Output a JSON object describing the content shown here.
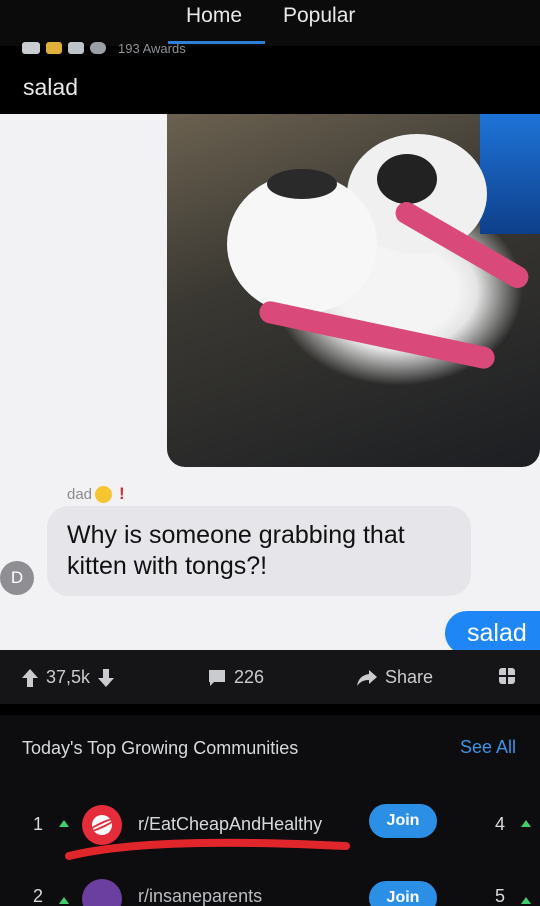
{
  "nav": {
    "tabs": [
      {
        "label": "Home"
      },
      {
        "label": "Popular"
      }
    ]
  },
  "post": {
    "awards_count": "193 Awards",
    "title": "salad",
    "image": {
      "sender_label": "dad",
      "incoming_message": "Why is someone grabbing that kitten with tongs?!",
      "avatar_letter": "D",
      "outgoing_message": "salad"
    },
    "actions": {
      "votes": "37,5k",
      "comments": "226",
      "share": "Share"
    }
  },
  "communities": {
    "title": "Today's Top Growing Communities",
    "see_all": "See All",
    "items": [
      {
        "rank": "1",
        "name": "r/EatCheapAndHealthy",
        "join": "Join",
        "right_rank": "4"
      },
      {
        "rank": "2",
        "name": "r/insaneparents",
        "join": "Join",
        "right_rank": "5"
      }
    ]
  },
  "colors": {
    "accent": "#2c8fe6",
    "link": "#3d93e6",
    "rising": "#3ecf6a",
    "annotation": "#e0262b"
  }
}
